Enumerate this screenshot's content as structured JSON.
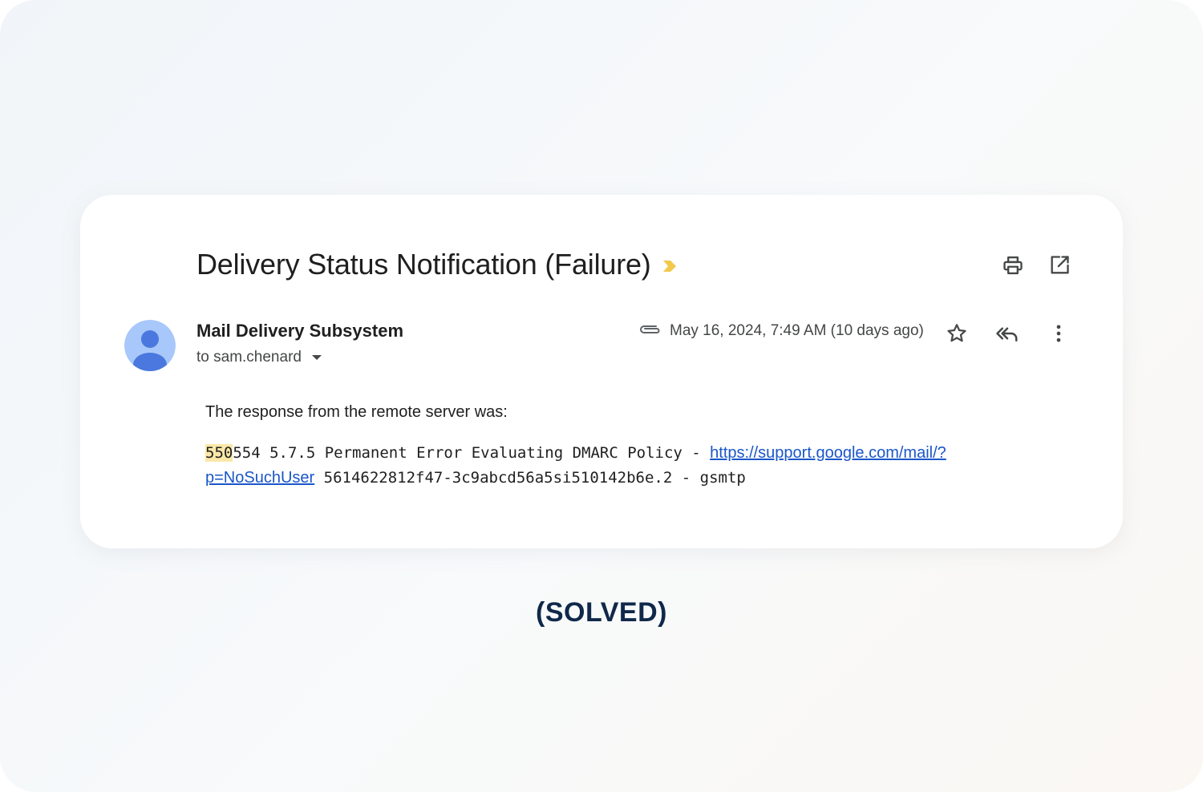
{
  "email": {
    "subject": "Delivery Status Notification (Failure)",
    "sender_name": "Mail Delivery Subsystem",
    "recipient_text": "to sam.chenard",
    "date": "May 16, 2024, 7:49 AM (10 days ago)",
    "body": {
      "intro": "The response from the remote server was:",
      "code_highlight": "550",
      "code_text": "554 5.7.5 Permanent Error Evaluating DMARC Policy - ",
      "link_text": "https://support.google.com/mail/?p=NoSuchUser",
      "code_tail": " 5614622812f47-3c9abcd56a5si510142b6e.2 - gsmtp"
    }
  },
  "caption": "(SOLVED)",
  "icons": {
    "importance": "importance-marker-icon",
    "print": "printer-icon",
    "open": "open-in-new-window-icon",
    "attachment": "attachment-clip-icon",
    "star": "star-outline-icon",
    "reply_all": "reply-all-icon",
    "more": "more-vertical-icon",
    "caret": "caret-down-icon",
    "avatar": "default-avatar-icon"
  },
  "colors": {
    "importance": "#f2c94c",
    "avatar_bg": "#a8c7fa",
    "avatar_fg": "#4a78de",
    "link": "#1a56c9",
    "highlight": "#fbe8a8",
    "caption": "#10284a"
  }
}
